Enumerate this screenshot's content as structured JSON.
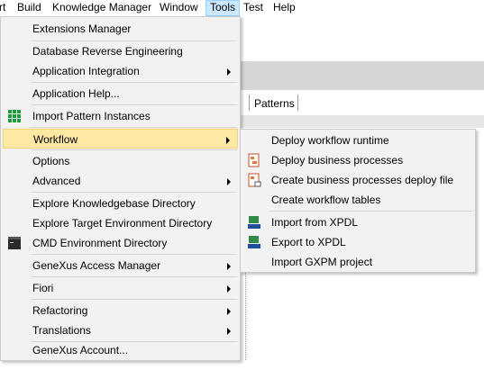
{
  "menubar": {
    "items": [
      {
        "label": "rt"
      },
      {
        "label": "Build"
      },
      {
        "label": "Knowledge Manager"
      },
      {
        "label": "Window"
      },
      {
        "label": "Tools"
      },
      {
        "label": "Test"
      },
      {
        "label": "Help"
      }
    ]
  },
  "background": {
    "tab_label": "Patterns"
  },
  "tools_menu": {
    "items": [
      {
        "label": "Extensions Manager"
      },
      {
        "label": "Database Reverse Engineering"
      },
      {
        "label": "Application Integration"
      },
      {
        "label": "Application Help..."
      },
      {
        "label": "Import Pattern Instances",
        "icon": "grid-icon"
      },
      {
        "label": "Workflow"
      },
      {
        "label": "Options"
      },
      {
        "label": "Advanced"
      },
      {
        "label": "Explore Knowledgebase Directory"
      },
      {
        "label": "Explore Target Environment Directory"
      },
      {
        "label": "CMD Environment Directory",
        "icon": "terminal-icon"
      },
      {
        "label": "GeneXus Access Manager"
      },
      {
        "label": "Fiori"
      },
      {
        "label": "Refactoring"
      },
      {
        "label": "Translations"
      },
      {
        "label": "GeneXus Account..."
      }
    ]
  },
  "workflow_submenu": {
    "items": [
      {
        "label": "Deploy workflow runtime"
      },
      {
        "label": "Deploy business processes",
        "icon": "deploy-process-icon"
      },
      {
        "label": "Create business processes deploy file",
        "icon": "deploy-file-icon"
      },
      {
        "label": "Create workflow tables"
      },
      {
        "label": "Import from XPDL",
        "icon": "xpdl-import-icon"
      },
      {
        "label": "Export to XPDL",
        "icon": "xpdl-export-icon"
      },
      {
        "label": "Import GXPM project"
      }
    ]
  },
  "colors": {
    "highlight": "#fde9a4",
    "menu_bg": "#f2f2f2",
    "active_menu": "#cce8ff"
  }
}
